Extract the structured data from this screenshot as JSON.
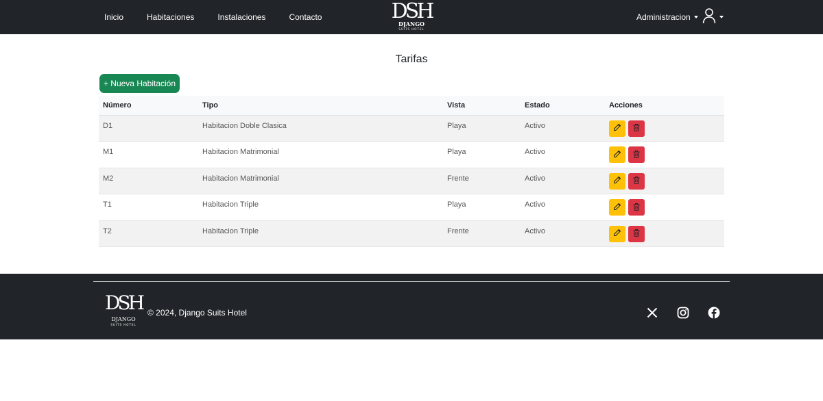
{
  "nav": {
    "links": [
      "Inicio",
      "Habitaciones",
      "Instalaciones",
      "Contacto"
    ],
    "brand": {
      "monogram": "DSH",
      "name": "DJANGO",
      "tagline": "SUITS HOTEL"
    },
    "admin_label": "Administracion",
    "user_icon": "user-icon"
  },
  "page": {
    "title": "Tarifas",
    "new_button": "+ Nueva Habitación"
  },
  "table": {
    "headers": [
      "Número",
      "Tipo",
      "Vista",
      "Estado",
      "Acciones"
    ],
    "rows": [
      {
        "numero": "D1",
        "tipo": "Habitacion Doble Clasica",
        "vista": "Playa",
        "estado": "Activo"
      },
      {
        "numero": "M1",
        "tipo": "Habitacion Matrimonial",
        "vista": "Playa",
        "estado": "Activo"
      },
      {
        "numero": "M2",
        "tipo": "Habitacion Matrimonial",
        "vista": "Frente",
        "estado": "Activo"
      },
      {
        "numero": "T1",
        "tipo": "Habitacion Triple",
        "vista": "Playa",
        "estado": "Activo"
      },
      {
        "numero": "T2",
        "tipo": "Habitacion Triple",
        "vista": "Frente",
        "estado": "Activo"
      }
    ],
    "action_icons": {
      "edit": "pencil-icon",
      "delete": "trash-icon"
    }
  },
  "footer": {
    "logo": {
      "monogram": "DSH",
      "name": "DJANGO",
      "tagline": "SUITS HOTEL"
    },
    "copyright": "© 2024, Django Suits Hotel",
    "social_icons": [
      "x-icon",
      "instagram-icon",
      "facebook-icon"
    ]
  },
  "colors": {
    "navbar": "#212529",
    "success": "#198754",
    "warning": "#ffc107",
    "danger": "#dc3545"
  }
}
